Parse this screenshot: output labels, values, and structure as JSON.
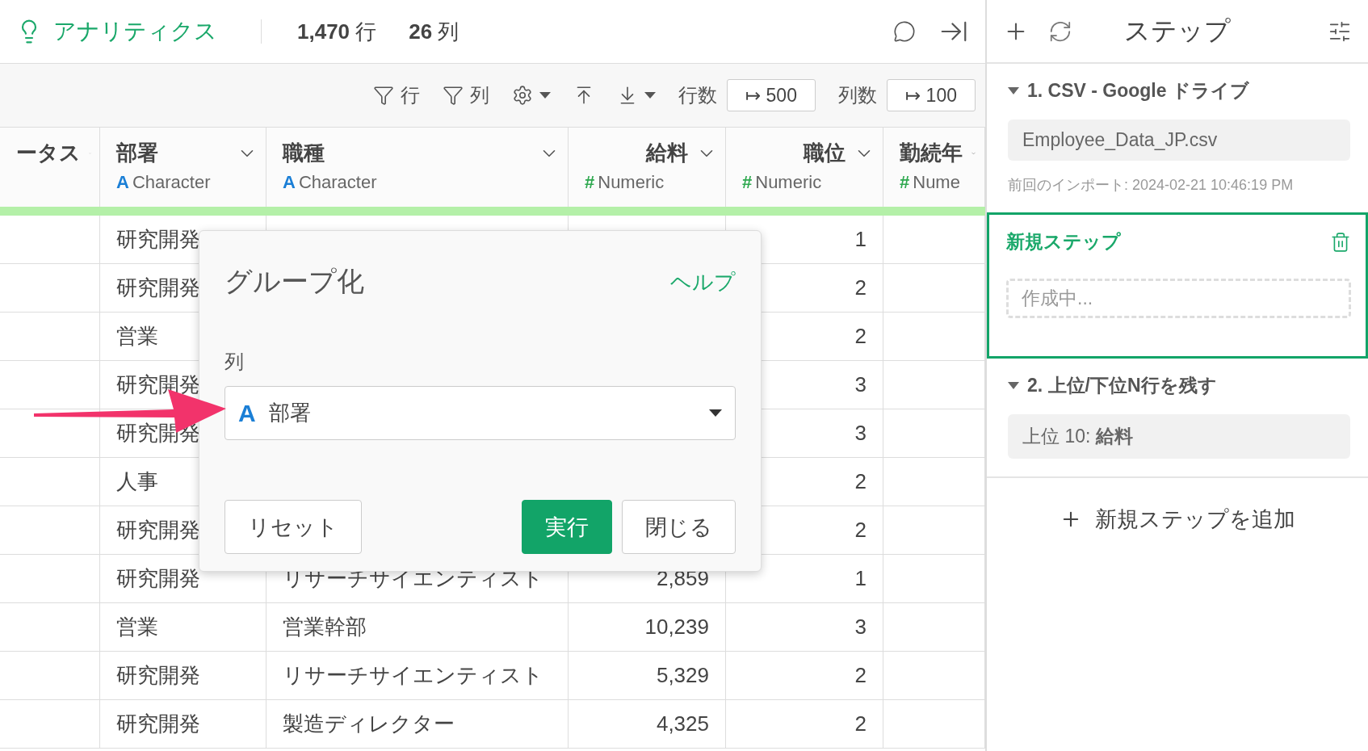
{
  "app": {
    "title": "アナリティクス",
    "row_count": "**1,470** 行",
    "col_count": "**26** 列"
  },
  "toolbar": {
    "row_filter": "行",
    "col_filter": "列",
    "rows_label": "行数",
    "rows_value": "↦ 500",
    "cols_label": "列数",
    "cols_value": "↦ 100"
  },
  "table": {
    "columns": [
      {
        "name": "ータス",
        "kind": "none"
      },
      {
        "name": "部署",
        "kind": "character",
        "type_icon": "A",
        "type_label": "Character"
      },
      {
        "name": "職種",
        "kind": "character",
        "type_icon": "A",
        "type_label": "Character"
      },
      {
        "name": "給料",
        "kind": "numeric",
        "type_icon": "#",
        "type_label": "Numeric"
      },
      {
        "name": "職位",
        "kind": "numeric",
        "type_icon": "#",
        "type_label": "Numeric"
      },
      {
        "name": "勤続年",
        "kind": "numeric",
        "type_icon": "#",
        "type_label": "Nume"
      }
    ],
    "rows": [
      [
        null,
        "研究開発",
        null,
        null,
        "1",
        null
      ],
      [
        null,
        "研究開発",
        null,
        null,
        "2",
        null
      ],
      [
        null,
        "営業",
        null,
        null,
        "2",
        null
      ],
      [
        null,
        "研究開発",
        null,
        null,
        "3",
        null
      ],
      [
        null,
        "研究開発",
        null,
        null,
        "3",
        null
      ],
      [
        null,
        "人事",
        null,
        null,
        "2",
        null
      ],
      [
        null,
        "研究開発",
        null,
        null,
        "2",
        null
      ],
      [
        null,
        "研究開発",
        "リサーチサイエンティスト",
        "2,859",
        "1",
        null
      ],
      [
        null,
        "営業",
        "営業幹部",
        "10,239",
        "3",
        null
      ],
      [
        null,
        "研究開発",
        "リサーチサイエンティスト",
        "5,329",
        "2",
        null
      ],
      [
        null,
        "研究開発",
        "製造ディレクター",
        "4,325",
        "2",
        null
      ]
    ]
  },
  "dialog": {
    "title": "グループ化",
    "help": "ヘルプ",
    "field_label": "列",
    "select": {
      "kind": "character",
      "type_icon": "A",
      "value": "部署"
    },
    "buttons": [
      {
        "label": "リセット",
        "kind": "secondary"
      },
      {
        "label": "実行",
        "kind": "primary"
      },
      {
        "label": "閉じる",
        "kind": "secondary"
      }
    ]
  },
  "steps_panel": {
    "title": "ステップ",
    "steps": [
      {
        "kind": "step",
        "label": "1. CSV - Google ドライブ",
        "expanded": true,
        "detail": "Employee_Data_JP.csv",
        "note": "前回のインポート: 2024-02-21 10:46:19 PM"
      },
      {
        "kind": "draft",
        "label": "新規ステップ",
        "selected": true,
        "placeholder": "作成中..."
      },
      {
        "kind": "step",
        "label": "2. 上位/下位N行を残す",
        "expanded": true,
        "detail": "上位 10: **給料**"
      }
    ],
    "add_button": "新規ステップを追加"
  }
}
